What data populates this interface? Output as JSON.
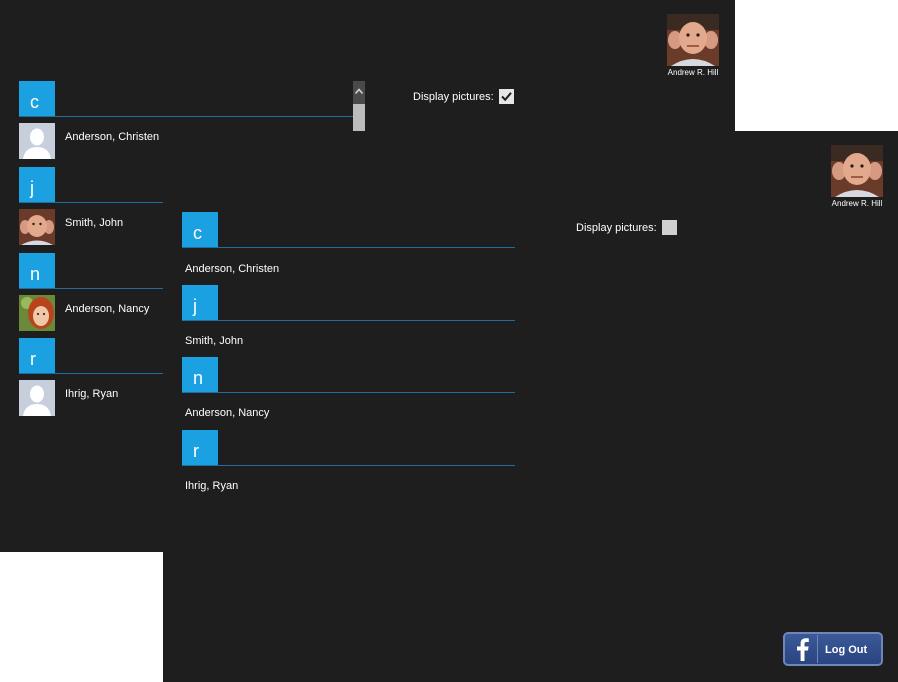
{
  "user": {
    "name": "Andrew R. Hill"
  },
  "options": {
    "display_pictures_label": "Display pictures:"
  },
  "contact_groups": [
    {
      "letter": "c",
      "contacts": [
        "Anderson, Christen"
      ]
    },
    {
      "letter": "j",
      "contacts": [
        "Smith, John"
      ]
    },
    {
      "letter": "n",
      "contacts": [
        "Anderson, Nancy"
      ]
    },
    {
      "letter": "r",
      "contacts": [
        "Ihrig, Ryan"
      ]
    }
  ],
  "logout": {
    "label": "Log Out",
    "icon": "facebook-icon"
  },
  "colors": {
    "background": "#1e1e1e",
    "group_accent": "#1ba1e2",
    "group_line": "#1f6f9e",
    "facebook_blue": "#3b5998"
  },
  "icons": {
    "checked": "checkbox-checked",
    "unchecked": "checkbox-unchecked",
    "scroll_up": "chevron-up-icon"
  }
}
